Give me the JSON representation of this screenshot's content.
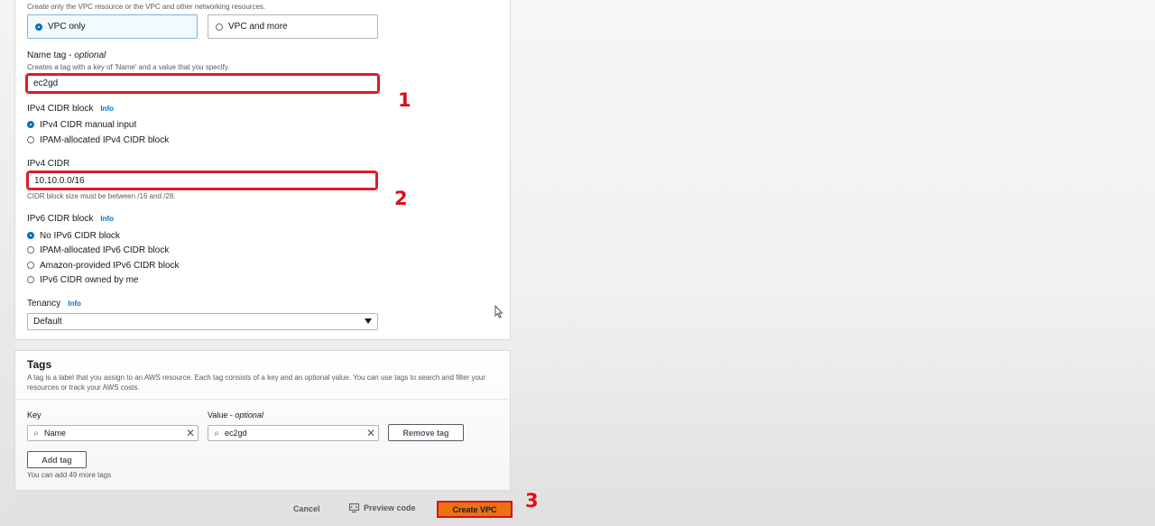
{
  "vpc_settings": {
    "resources_hint": "Create only the VPC resource or the VPC and other networking resources.",
    "resource_options": [
      {
        "label": "VPC only",
        "selected": true
      },
      {
        "label": "VPC and more",
        "selected": false
      }
    ],
    "name_tag": {
      "label": "Name tag",
      "optional": "optional",
      "hint": "Creates a tag with a key of 'Name' and a value that you specify.",
      "value": "ec2gd"
    },
    "ipv4_block": {
      "label": "IPv4 CIDR block",
      "info": "Info",
      "options": [
        {
          "label": "IPv4 CIDR manual input",
          "selected": true
        },
        {
          "label": "IPAM-allocated IPv4 CIDR block",
          "selected": false
        }
      ]
    },
    "ipv4_cidr": {
      "label": "IPv4 CIDR",
      "value": "10.10.0.0/16",
      "hint": "CIDR block size must be between /16 and /28."
    },
    "ipv6_block": {
      "label": "IPv6 CIDR block",
      "info": "Info",
      "options": [
        {
          "label": "No IPv6 CIDR block",
          "selected": true
        },
        {
          "label": "IPAM-allocated IPv6 CIDR block",
          "selected": false
        },
        {
          "label": "Amazon-provided IPv6 CIDR block",
          "selected": false
        },
        {
          "label": "IPv6 CIDR owned by me",
          "selected": false
        }
      ]
    },
    "tenancy": {
      "label": "Tenancy",
      "info": "Info",
      "value": "Default"
    }
  },
  "tags": {
    "title": "Tags",
    "description": "A tag is a label that you assign to an AWS resource. Each tag consists of a key and an optional value. You can use tags to search and filter your resources or track your AWS costs.",
    "key_label": "Key",
    "value_label": "Value",
    "value_optional": "optional",
    "rows": [
      {
        "key": "Name",
        "value": "ec2gd"
      }
    ],
    "remove_label": "Remove tag",
    "add_label": "Add tag",
    "remaining_hint": "You can add 49 more tags"
  },
  "footer": {
    "cancel": "Cancel",
    "preview": "Preview code",
    "create": "Create VPC"
  },
  "annotations": {
    "step1": "1",
    "step2": "2",
    "step3": "3"
  },
  "colors": {
    "accent": "#0073bb",
    "primary_button": "#ec7211",
    "highlight": "#e01b24"
  }
}
